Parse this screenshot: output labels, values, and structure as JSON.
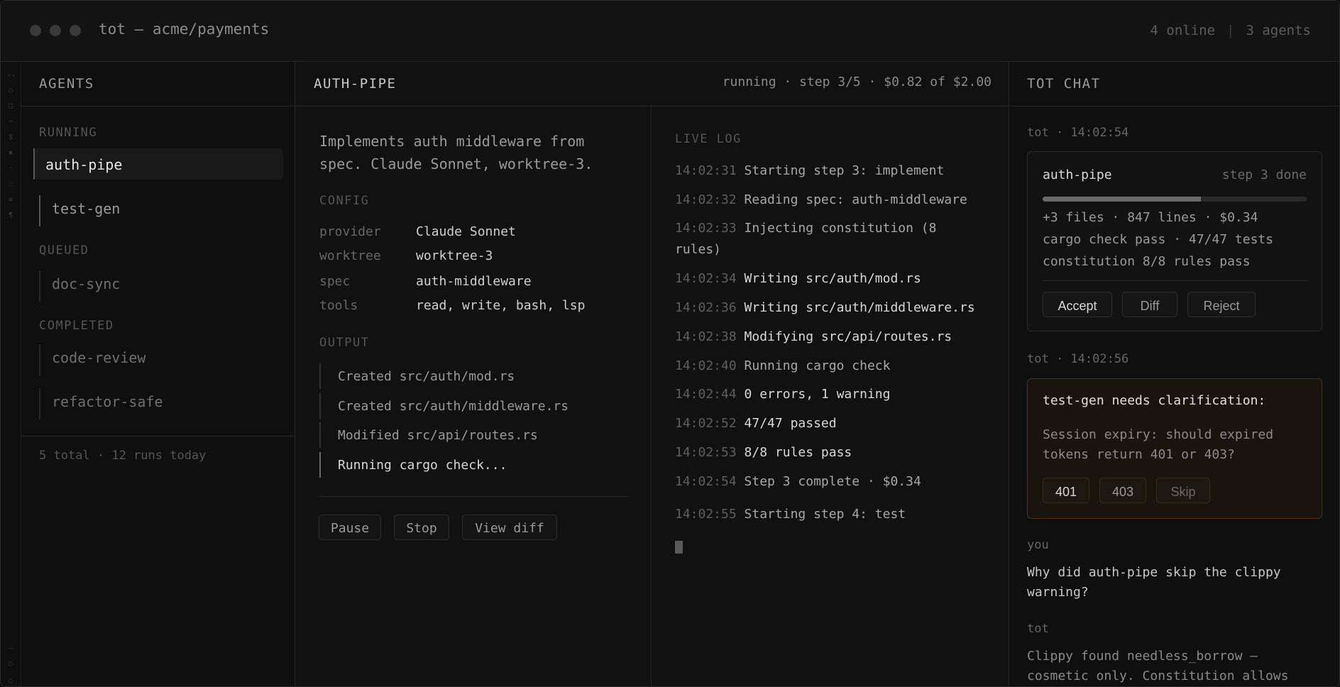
{
  "titlebar": {
    "title": "tot — acme/payments",
    "online": "4 online",
    "agents_count": "3 agents"
  },
  "agents_panel": {
    "header": "AGENTS",
    "sections": {
      "running": "RUNNING",
      "queued": "QUEUED",
      "completed": "COMPLETED"
    },
    "running": [
      "auth-pipe",
      "test-gen"
    ],
    "queued": [
      "doc-sync"
    ],
    "completed": [
      "code-review",
      "refactor-safe"
    ],
    "footer": "5 total · 12 runs today"
  },
  "main": {
    "header": "AUTH-PIPE",
    "status": "running · step 3/5 · $0.82 of $2.00",
    "description": "Implements auth middleware from spec. Claude Sonnet, worktree-3.",
    "config_title": "CONFIG",
    "config": [
      {
        "key": "provider",
        "value": "Claude Sonnet"
      },
      {
        "key": "worktree",
        "value": "worktree-3"
      },
      {
        "key": "spec",
        "value": "auth-middleware"
      },
      {
        "key": "tools",
        "value": "read, write, bash, lsp"
      }
    ],
    "output_title": "OUTPUT",
    "output": [
      "Created src/auth/mod.rs",
      "Created src/auth/middleware.rs",
      "Modified src/api/routes.rs",
      "Running cargo check..."
    ],
    "buttons": {
      "pause": "Pause",
      "stop": "Stop",
      "view_diff": "View diff"
    }
  },
  "log": {
    "title": "LIVE LOG",
    "entries": [
      {
        "ts": "14:02:31",
        "text": "Starting step 3: implement"
      },
      {
        "ts": "14:02:32",
        "text": "Reading spec: auth-middleware"
      },
      {
        "ts": "14:02:33",
        "text": "Injecting constitution (8 rules)"
      },
      {
        "ts": "14:02:34",
        "text": "Writing src/auth/mod.rs"
      },
      {
        "ts": "14:02:36",
        "text": "Writing src/auth/middleware.rs"
      },
      {
        "ts": "14:02:38",
        "text": "Modifying src/api/routes.rs"
      },
      {
        "ts": "14:02:40",
        "text": "Running cargo check"
      },
      {
        "ts": "14:02:44",
        "text": "0 errors, 1 warning"
      },
      {
        "ts": "14:02:52",
        "text": "47/47 passed"
      },
      {
        "ts": "14:02:53",
        "text": "8/8 rules pass"
      },
      {
        "ts": "14:02:54",
        "text": "Step 3 complete · $0.34"
      },
      {
        "ts": "14:02:55",
        "text": "Starting step 4: test"
      }
    ]
  },
  "chat": {
    "header": "TOT CHAT",
    "msg1_meta": "tot · 14:02:54",
    "card": {
      "agent": "auth-pipe",
      "step": "step 3 done",
      "progress": 0.6,
      "line1": "+3 files · 847 lines · $0.34",
      "line2": "cargo check pass · 47/47 tests",
      "line3": "constitution 8/8 rules pass",
      "accept": "Accept",
      "diff": "Diff",
      "reject": "Reject"
    },
    "msg2_meta": "tot · 14:02:56",
    "question": {
      "title": "test-gen needs clarification:",
      "body": "Session expiry: should expired tokens return 401 or 403?",
      "opt1": "401",
      "opt2": "403",
      "skip": "Skip"
    },
    "you_meta": "you",
    "you_msg": "Why did auth-pipe skip the clippy warning?",
    "tot_meta": "tot",
    "tot_msg": "Clippy found needless_borrow — cosmetic only. Constitution allows"
  },
  "colors": {
    "accent_warning_border": "#4a321c",
    "background": "#111111"
  }
}
